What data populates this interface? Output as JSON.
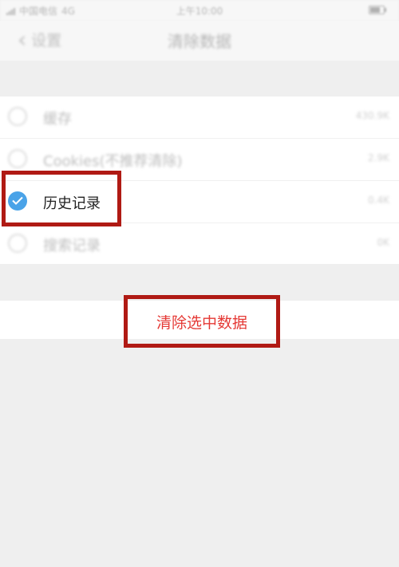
{
  "status_bar": {
    "carrier": "中国电信",
    "network": "4G",
    "time": "上午10:00"
  },
  "nav": {
    "back_label": "设置",
    "title": "清除数据"
  },
  "items": [
    {
      "label": "缓存",
      "size": "430.9K",
      "checked": false
    },
    {
      "label": "Cookies(不推荐清除)",
      "size": "2.9K",
      "checked": false
    },
    {
      "label": "历史记录",
      "size": "0.4K",
      "checked": true
    },
    {
      "label": "搜索记录",
      "size": "0K",
      "checked": false
    }
  ],
  "action": {
    "clear_label": "清除选中数据"
  },
  "colors": {
    "accent": "#4aa3e8",
    "danger_text": "#e53935",
    "highlight": "#b01a14"
  }
}
